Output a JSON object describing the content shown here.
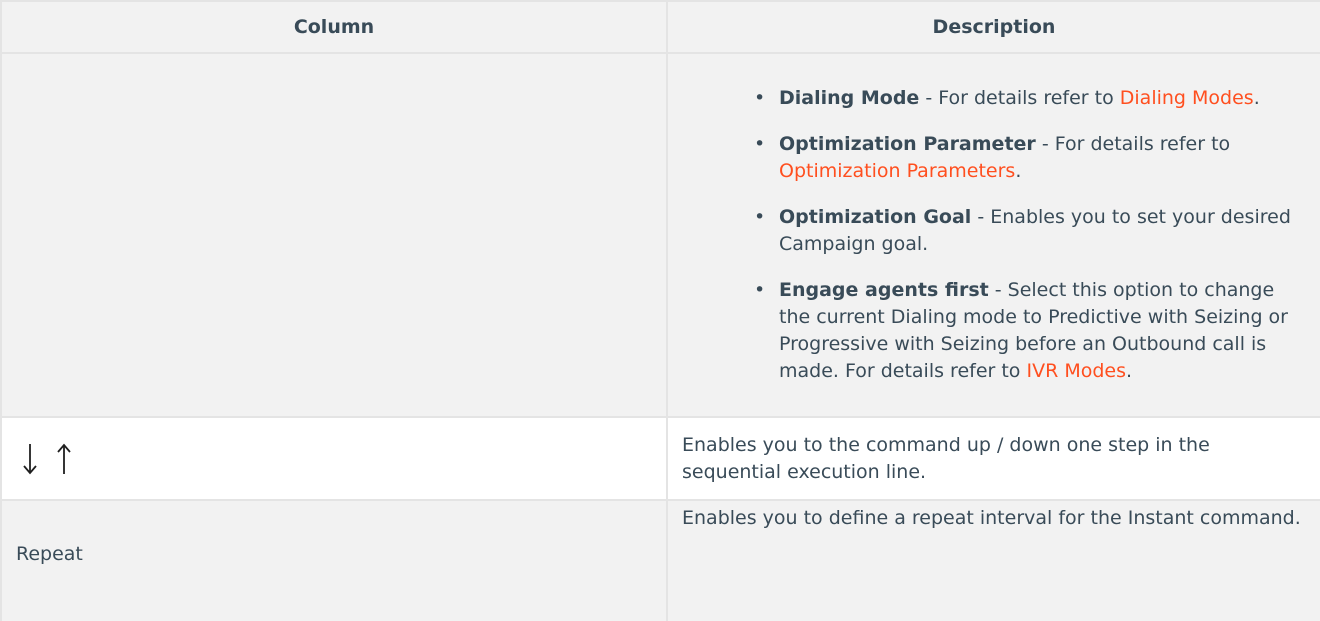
{
  "table": {
    "headers": {
      "column": "Column",
      "description": "Description"
    },
    "row1": {
      "items": [
        {
          "term": "Dialing Mode",
          "text": " - For details refer to ",
          "link": "Dialing Modes",
          "after": "."
        },
        {
          "term": "Optimization Parameter",
          "text": " - For details refer to ",
          "link": "Optimization Parameters",
          "after": "."
        },
        {
          "term": "Optimization Goal",
          "text": " - Enables you to set your desired Campaign goal.",
          "link": "",
          "after": ""
        },
        {
          "term": "Engage agents first",
          "text": " - Select this option to change the current Dialing mode to Predictive with Seizing or Progressive with Seizing before an Outbound call is made. For details refer to ",
          "link": "IVR Modes",
          "after": "."
        }
      ]
    },
    "row2": {
      "icons": [
        "arrow-down-icon",
        "arrow-up-icon"
      ],
      "description": "Enables you to the command up / down one step in the sequential execution line."
    },
    "row3": {
      "name": "Repeat",
      "description": "Enables you to define a repeat interval for the Instant command."
    }
  }
}
